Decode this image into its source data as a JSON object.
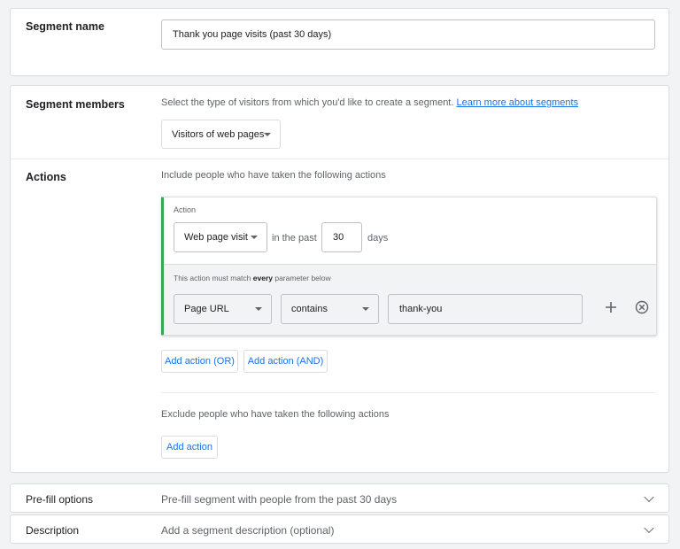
{
  "segment_name": {
    "label": "Segment name",
    "value": "Thank you page visits (past 30 days)"
  },
  "segment_members": {
    "label": "Segment members",
    "description": "Select the type of visitors from which you'd like to create a segment.",
    "learn_more": "Learn more about segments",
    "visitor_type": "Visitors of web pages"
  },
  "actions": {
    "label": "Actions",
    "include_text": "Include people who have taken the following actions",
    "action_label": "Action",
    "action_type": "Web page visit",
    "in_the_past": "in the past",
    "days_value": "30",
    "days_label": "days",
    "match_prefix": "This action must match ",
    "match_emph": "every",
    "match_suffix": " parameter below",
    "param_field": "Page URL",
    "param_operator": "contains",
    "param_value": "thank-you",
    "add_or": "Add action (OR)",
    "add_and": "Add action (AND)",
    "exclude_text": "Exclude people who have taken the following actions",
    "add_action": "Add action"
  },
  "prefill": {
    "label": "Pre-fill options",
    "text": "Pre-fill segment with people from the past 30 days"
  },
  "description": {
    "label": "Description",
    "text": "Add a segment description (optional)"
  },
  "colors": {
    "accent": "#1a73e8",
    "action_border": "#34a853"
  },
  "icons": [
    "plus-icon",
    "remove-circle-icon",
    "dropdown-caret-icon",
    "chevron-down-icon"
  ]
}
